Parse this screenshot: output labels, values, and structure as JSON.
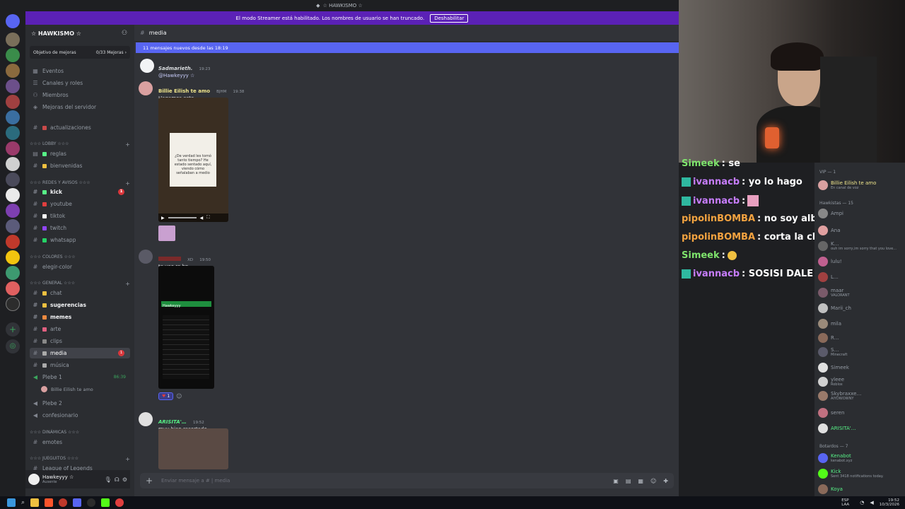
{
  "window": {
    "title": "☆ HAWKISMO ☆"
  },
  "banner": {
    "text": "El modo Streamer está habilitado. Los nombres de usuario se han truncado.",
    "button": "Deshabilitar"
  },
  "server": {
    "name": "☆ HAWKISMO ☆",
    "goal_label": "Objetivo de mejoras",
    "goal_progress": "0/33 Mejoras ›"
  },
  "menu": [
    "Eventos",
    "Canales y roles",
    "Miembros",
    "Mejoras del servidor"
  ],
  "channels": {
    "updates": "actualizaciones",
    "cat_lobby": "☆☆☆ LOBBY ☆☆☆",
    "reglas": "reglas",
    "bienvenidas": "bienvenidas",
    "cat_redes": "☆☆☆ REDES Y AVISOS ☆☆☆",
    "kick": "kick",
    "youtube": "youtube",
    "tiktok": "tiktok",
    "twitch": "twitch",
    "whatsapp": "whatsapp",
    "cat_colores": "☆☆☆ COLORES ☆☆☆",
    "elegir_color": "elegir-color",
    "cat_general": "☆☆☆ GENERAL ☆☆☆",
    "chat": "chat",
    "sugerencias": "sugerencias",
    "memes": "memes",
    "arte": "arte",
    "clips": "clips",
    "media": "media",
    "musica": "música",
    "plebe1": "Plebe 1",
    "plebe1_time": "86:39",
    "plebe1_user": "Billie Eilish te amo",
    "plebe2": "Plebe 2",
    "confesionario": "confesionario",
    "cat_dinamicas": "☆☆☆ DINÁMICAS ☆☆☆",
    "emotes": "emotes",
    "cat_juegos": "☆☆☆ JUEGUITOS ☆☆☆",
    "league": "League of Legends",
    "kick_badge": "1",
    "media_badge": "1"
  },
  "user": {
    "name": "Hawkeyyy ☆",
    "status": "Ausente"
  },
  "chat": {
    "channel": "media",
    "new_messages": "11 mensajes nuevos desde las 18:19",
    "messages": [
      {
        "author": "Sadmarieth.",
        "time": "19:23",
        "text": "@Hawkeyyy ☆",
        "color": "#dbdee1"
      },
      {
        "author": "Billie Eilish te amo",
        "tag": "BJHM",
        "time": "19:38",
        "text": "Hagamos este",
        "color": "#f0e68c"
      },
      {
        "author": "",
        "tag": "XD",
        "time": "19:50",
        "text": "te veo re bn",
        "color": "#e03e3e"
      },
      {
        "author": "ARISITA'…",
        "time": "19:52",
        "text": "muy bien recortado",
        "color": "#57f287"
      }
    ],
    "image_text": "¿De verdad les tomó tanto tiempo? He estado sentado aquí, viendo cómo señalaban a medio",
    "phone_title": "Hawkeyyy",
    "reaction_count": "1",
    "composer_placeholder": "Enviar mensaje a #  |  media"
  },
  "overlay_chat": [
    {
      "user": "Simeek",
      "text": " : se",
      "color": "#7ee36c"
    },
    {
      "user": "ivannacb",
      "text": " : yo lo hago",
      "color": "#c77dff"
    },
    {
      "user": "ivannacb",
      "text": " : ",
      "color": "#c77dff"
    },
    {
      "user": "pipolinBOMBA",
      "text": " : no soy albañil pero re laburo",
      "color": "#f4a340"
    },
    {
      "user": "pipolinBOMBA",
      "text": " : corta la chepi",
      "color": "#f4a340"
    },
    {
      "user": "Simeek",
      "text": " : ",
      "color": "#7ee36c"
    },
    {
      "user": "ivannacb",
      "text": " : SOSISI DALE",
      "color": "#c77dff"
    }
  ],
  "members": {
    "vip_header": "VIP — 1",
    "hawkistas_header": "Hawkistas — 15",
    "botardos_header": "Botardos — 7",
    "list": [
      {
        "name": "Billie Eilish te amo",
        "sub": "En canal de voz",
        "color": "#f0e68c"
      },
      {
        "name": "Ampi",
        "sub": "",
        "color": "#949ba4"
      },
      {
        "name": "Ana",
        "sub": "",
        "color": "#949ba4"
      },
      {
        "name": "K…",
        "sub": "ouh im sorry,im sorry that you love...",
        "color": "#949ba4"
      },
      {
        "name": "lulu!",
        "sub": "",
        "color": "#949ba4"
      },
      {
        "name": "L…",
        "sub": "",
        "color": "#949ba4"
      },
      {
        "name": "maar",
        "sub": "VALORANT",
        "color": "#949ba4"
      },
      {
        "name": "Marii_ch",
        "sub": "",
        "color": "#949ba4"
      },
      {
        "name": "mila",
        "sub": "",
        "color": "#949ba4"
      },
      {
        "name": "R…",
        "sub": "",
        "color": "#949ba4"
      },
      {
        "name": "S…",
        "sub": "Minecraft",
        "color": "#949ba4"
      },
      {
        "name": "Simeek",
        "sub": "",
        "color": "#949ba4"
      },
      {
        "name": "yleee",
        "sub": "Roblox",
        "color": "#949ba4"
      },
      {
        "name": "Skybraxxe…",
        "sub": "AIYDWOWNY",
        "color": "#949ba4"
      },
      {
        "name": "seren",
        "sub": "",
        "color": "#949ba4"
      },
      {
        "name": "ARISITA'…",
        "sub": "",
        "color": "#57f287"
      },
      {
        "name": "Kenabot",
        "sub": "kenabot.xyz",
        "color": "#57f287"
      },
      {
        "name": "Kick",
        "sub": "Sent 3418 notifications today.",
        "color": "#57f287"
      },
      {
        "name": "Koya",
        "sub": "",
        "color": "#57f287"
      }
    ]
  },
  "taskbar": {
    "lang": "ESP LAA",
    "time": "19:52",
    "date": "10/3/2026"
  }
}
